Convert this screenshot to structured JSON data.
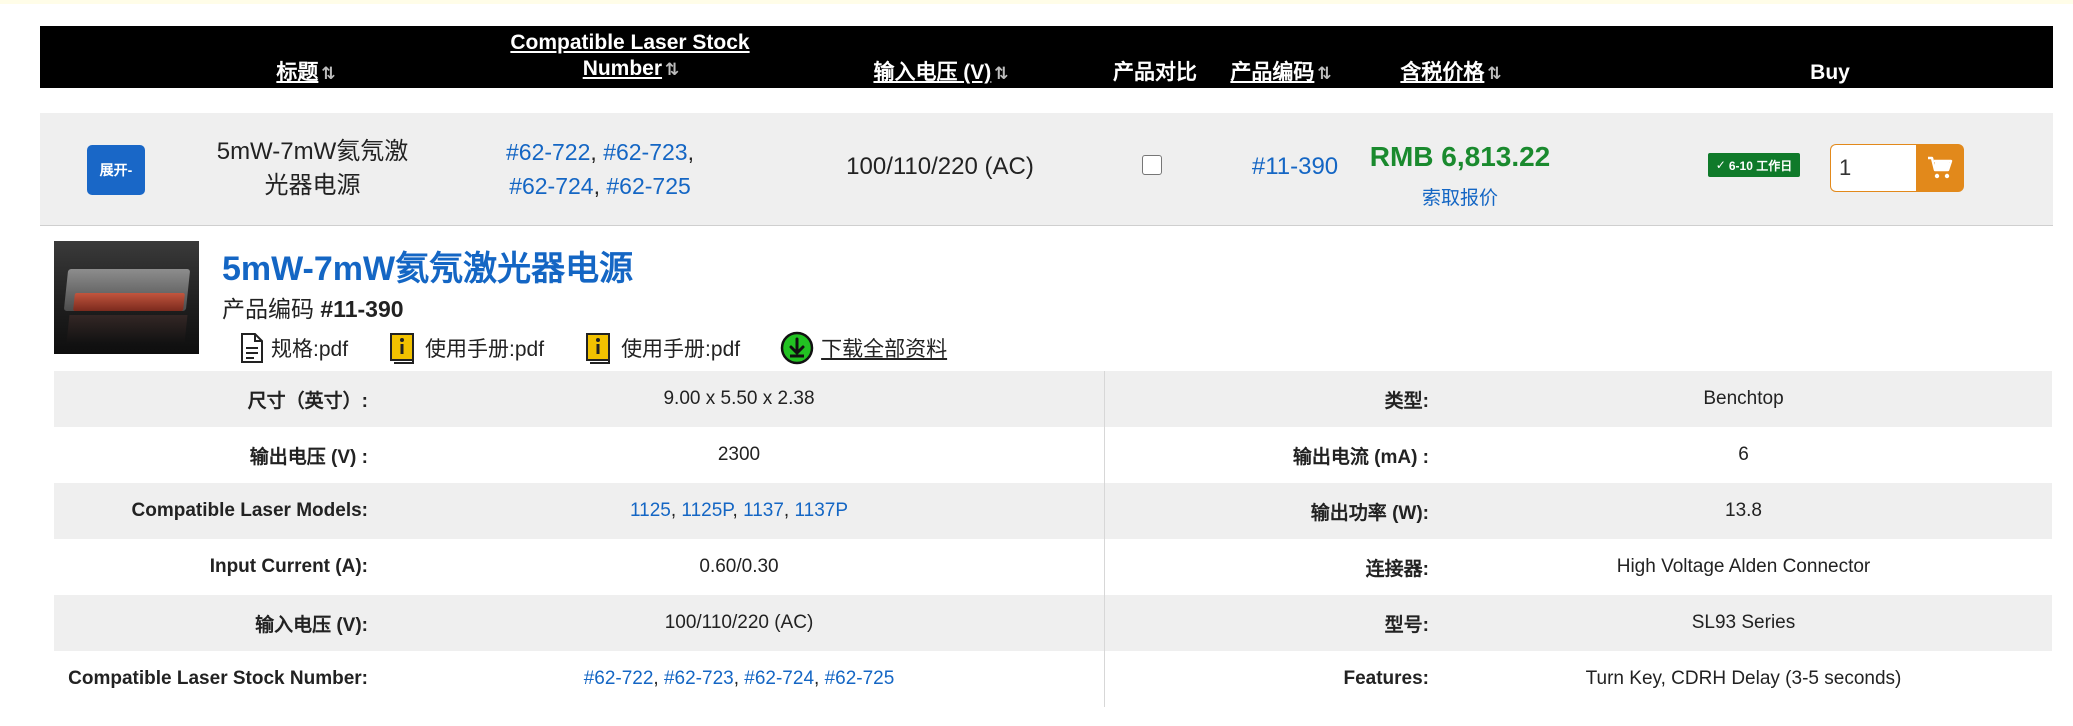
{
  "header": {
    "title": "标题",
    "stock_line1": "Compatible Laser Stock",
    "stock_line2": "Number",
    "voltage": "输入电压 (V)",
    "compare": "产品对比",
    "code": "产品编码",
    "price": "含税价格",
    "buy": "Buy",
    "sort_glyph": "⇅"
  },
  "product": {
    "expand_label": "展开-",
    "title": "5mW-7mW氦氖激光器电源",
    "stock_numbers": [
      "#62-722",
      "#62-723",
      "#62-724",
      "#62-725"
    ],
    "voltage": "100/110/220 (AC)",
    "code": "#11-390",
    "price": "RMB 6,813.22",
    "quote_label": "索取报价",
    "badge": "6-10 工作日",
    "quantity": "1"
  },
  "detail": {
    "title": "5mW-7mW氦氖激光器电源",
    "code_label": "产品编码",
    "code_value": "#11-390",
    "docs": [
      {
        "label": "规格:pdf",
        "icon": "document-icon"
      },
      {
        "label": "使用手册:pdf",
        "icon": "manual-info-icon"
      },
      {
        "label": "使用手册:pdf",
        "icon": "manual-info-icon"
      },
      {
        "label": "下载全部资料",
        "icon": "download-icon"
      }
    ]
  },
  "specs": {
    "left": [
      {
        "label": "尺寸（英寸）:",
        "value": "9.00 x 5.50 x 2.38"
      },
      {
        "label": "输出电压 (V) :",
        "value": "2300"
      },
      {
        "label": "Compatible Laser Models:",
        "links": [
          "1125",
          "1125P",
          "1137",
          "1137P"
        ]
      },
      {
        "label": "Input Current (A):",
        "value": "0.60/0.30"
      },
      {
        "label": "输入电压 (V):",
        "value": "100/110/220 (AC)"
      },
      {
        "label": "Compatible Laser Stock Number:",
        "links": [
          "#62-722",
          "#62-723",
          "#62-724",
          "#62-725"
        ]
      }
    ],
    "right": [
      {
        "label": "类型:",
        "value": "Benchtop"
      },
      {
        "label": "输出电流 (mA) :",
        "value": "6"
      },
      {
        "label": "输出功率 (W):",
        "value": "13.8"
      },
      {
        "label": "连接器:",
        "value": "High Voltage Alden Connector"
      },
      {
        "label": "型号:",
        "value": "SL93 Series"
      },
      {
        "label": "Features:",
        "value": "Turn Key, CDRH Delay (3-5 seconds)"
      }
    ]
  },
  "colors": {
    "link": "#1466c4",
    "price": "#1a8a2e",
    "expand_button": "#1967c7",
    "cart": "#e2891b",
    "badge": "#0f7a2a"
  }
}
